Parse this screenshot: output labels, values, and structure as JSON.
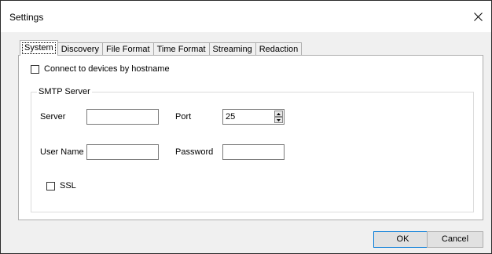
{
  "window": {
    "title": "Settings"
  },
  "tabs": [
    {
      "label": "System",
      "active": true
    },
    {
      "label": "Discovery",
      "active": false
    },
    {
      "label": "File Format",
      "active": false
    },
    {
      "label": "Time Format",
      "active": false
    },
    {
      "label": "Streaming",
      "active": false
    },
    {
      "label": "Redaction",
      "active": false
    }
  ],
  "system": {
    "connect_hostname_label": "Connect to devices by hostname",
    "connect_hostname_checked": false,
    "smtp": {
      "group_title": "SMTP Server",
      "server_label": "Server",
      "server_value": "",
      "port_label": "Port",
      "port_value": "25",
      "username_label": "User Name",
      "username_value": "",
      "password_label": "Password",
      "password_value": "",
      "ssl_label": "SSL",
      "ssl_checked": false
    }
  },
  "buttons": {
    "ok": "OK",
    "cancel": "Cancel"
  },
  "icons": {
    "close": "close-icon",
    "spin_up": "chevron-up-icon",
    "spin_down": "chevron-down-icon"
  },
  "colors": {
    "default_button_border": "#0078d7",
    "client_background": "#f0f0f0"
  }
}
